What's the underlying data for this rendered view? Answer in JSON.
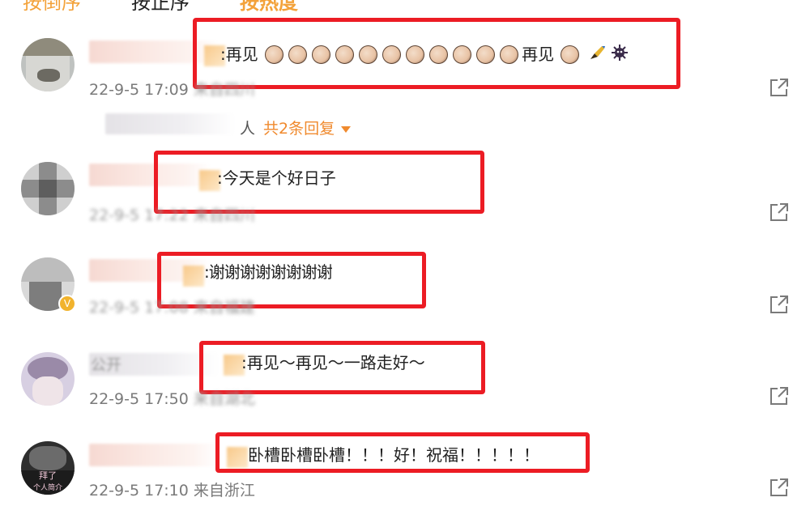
{
  "tabs": [
    {
      "label": "按倒序",
      "color": "#f3a23a"
    },
    {
      "label": "按正序",
      "color": "#222222"
    },
    {
      "label": "按热度",
      "color": "#f3a23a"
    }
  ],
  "comments": [
    {
      "text_pre": ":再见",
      "text_post": "再见",
      "hand_count_pre": 11,
      "meta_date": "22-9-5 17:09",
      "meta_location": "来自四川",
      "replies_label": "人",
      "replies_link": "共2条回复"
    },
    {
      "text": ":今天是个好日子",
      "meta_date": "22-9-5 17:22",
      "meta_location": "来自四川"
    },
    {
      "text": ":谢谢谢谢谢谢谢谢",
      "meta_date": "22-9-5 17:08",
      "meta_location": "来自福建"
    },
    {
      "text": ":再见～再见～一路走好～",
      "name_partial": "公开",
      "meta_date": "22-9-5 17:50",
      "meta_location": "来自湖北"
    },
    {
      "text": "卧槽卧槽卧槽！！！好！祝福！！！！！",
      "meta_date": "22-9-5 17:10",
      "meta_location": "来自浙江",
      "avatar_text_1": "拜了",
      "avatar_text_2": "个人简介"
    }
  ],
  "icons": {
    "share": "share-icon",
    "hand": "waving-hand-icon",
    "pencil": "pencil-icon",
    "virus": "virus-icon",
    "verified": "verified-badge-icon"
  },
  "colors": {
    "accent": "#f3a23a",
    "highlight_box": "#ec1c24",
    "meta": "#7a7a7a"
  }
}
